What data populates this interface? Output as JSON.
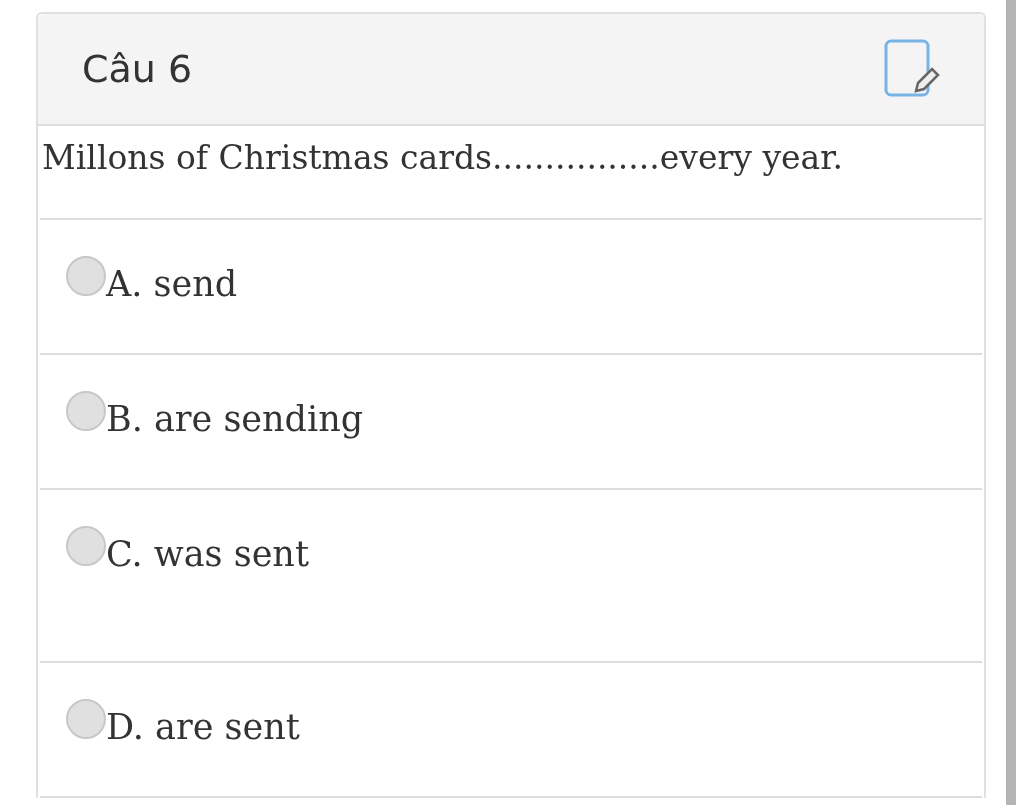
{
  "question": {
    "title": "Câu 6",
    "text": "Millons of Christmas cards................every year.",
    "options": [
      {
        "label": "A. send",
        "selected": false
      },
      {
        "label": "B. are sending",
        "selected": false
      },
      {
        "label": "C. was sent",
        "selected": false
      },
      {
        "label": "D. are sent",
        "selected": false
      }
    ]
  }
}
